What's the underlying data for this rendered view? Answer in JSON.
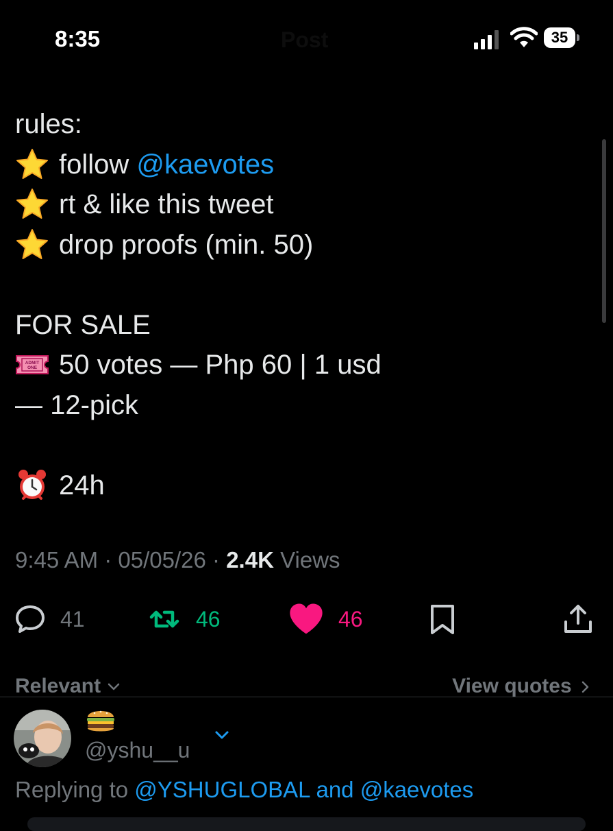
{
  "status_bar": {
    "time": "8:35",
    "ghost_title": "Post",
    "battery": "35"
  },
  "post": {
    "lines": {
      "rules_heading": "rules:",
      "rule1_prefix": "follow ",
      "rule1_mention": "@kaevotes",
      "rule2": "rt & like this tweet",
      "rule3": "drop proofs (min. 50)",
      "sale_heading": "FOR SALE",
      "sale_line1": "50 votes — Php 60 | 1 usd",
      "sale_line2": "— 12-pick",
      "duration": "24h"
    },
    "icons": {
      "star": "star-emoji",
      "ticket": "admission-ticket-emoji",
      "clock": "alarm-clock-emoji"
    },
    "ticket_text": "ADMIT ONE",
    "meta": {
      "time": "9:45 AM",
      "sep1": " · ",
      "date": "05/05/26",
      "sep2": " · ",
      "views_count": "2.4K",
      "views_label": " Views"
    },
    "actions": {
      "replies": "41",
      "reposts": "46",
      "likes": "46"
    }
  },
  "replies_header": {
    "sort_label": "Relevant",
    "view_quotes": "View quotes"
  },
  "reply": {
    "display_name_emoji": "hamburger-emoji",
    "handle": "@yshu__u",
    "replying_prefix": "Replying to ",
    "replying_to_1": "@YSHUGLOBAL",
    "replying_and": " and ",
    "replying_to_2": "@kaevotes"
  },
  "colors": {
    "background": "#000000",
    "text": "#e7e9ea",
    "muted": "#71767b",
    "link": "#1d9bf0",
    "repost": "#00ba7c",
    "like": "#f91880"
  }
}
